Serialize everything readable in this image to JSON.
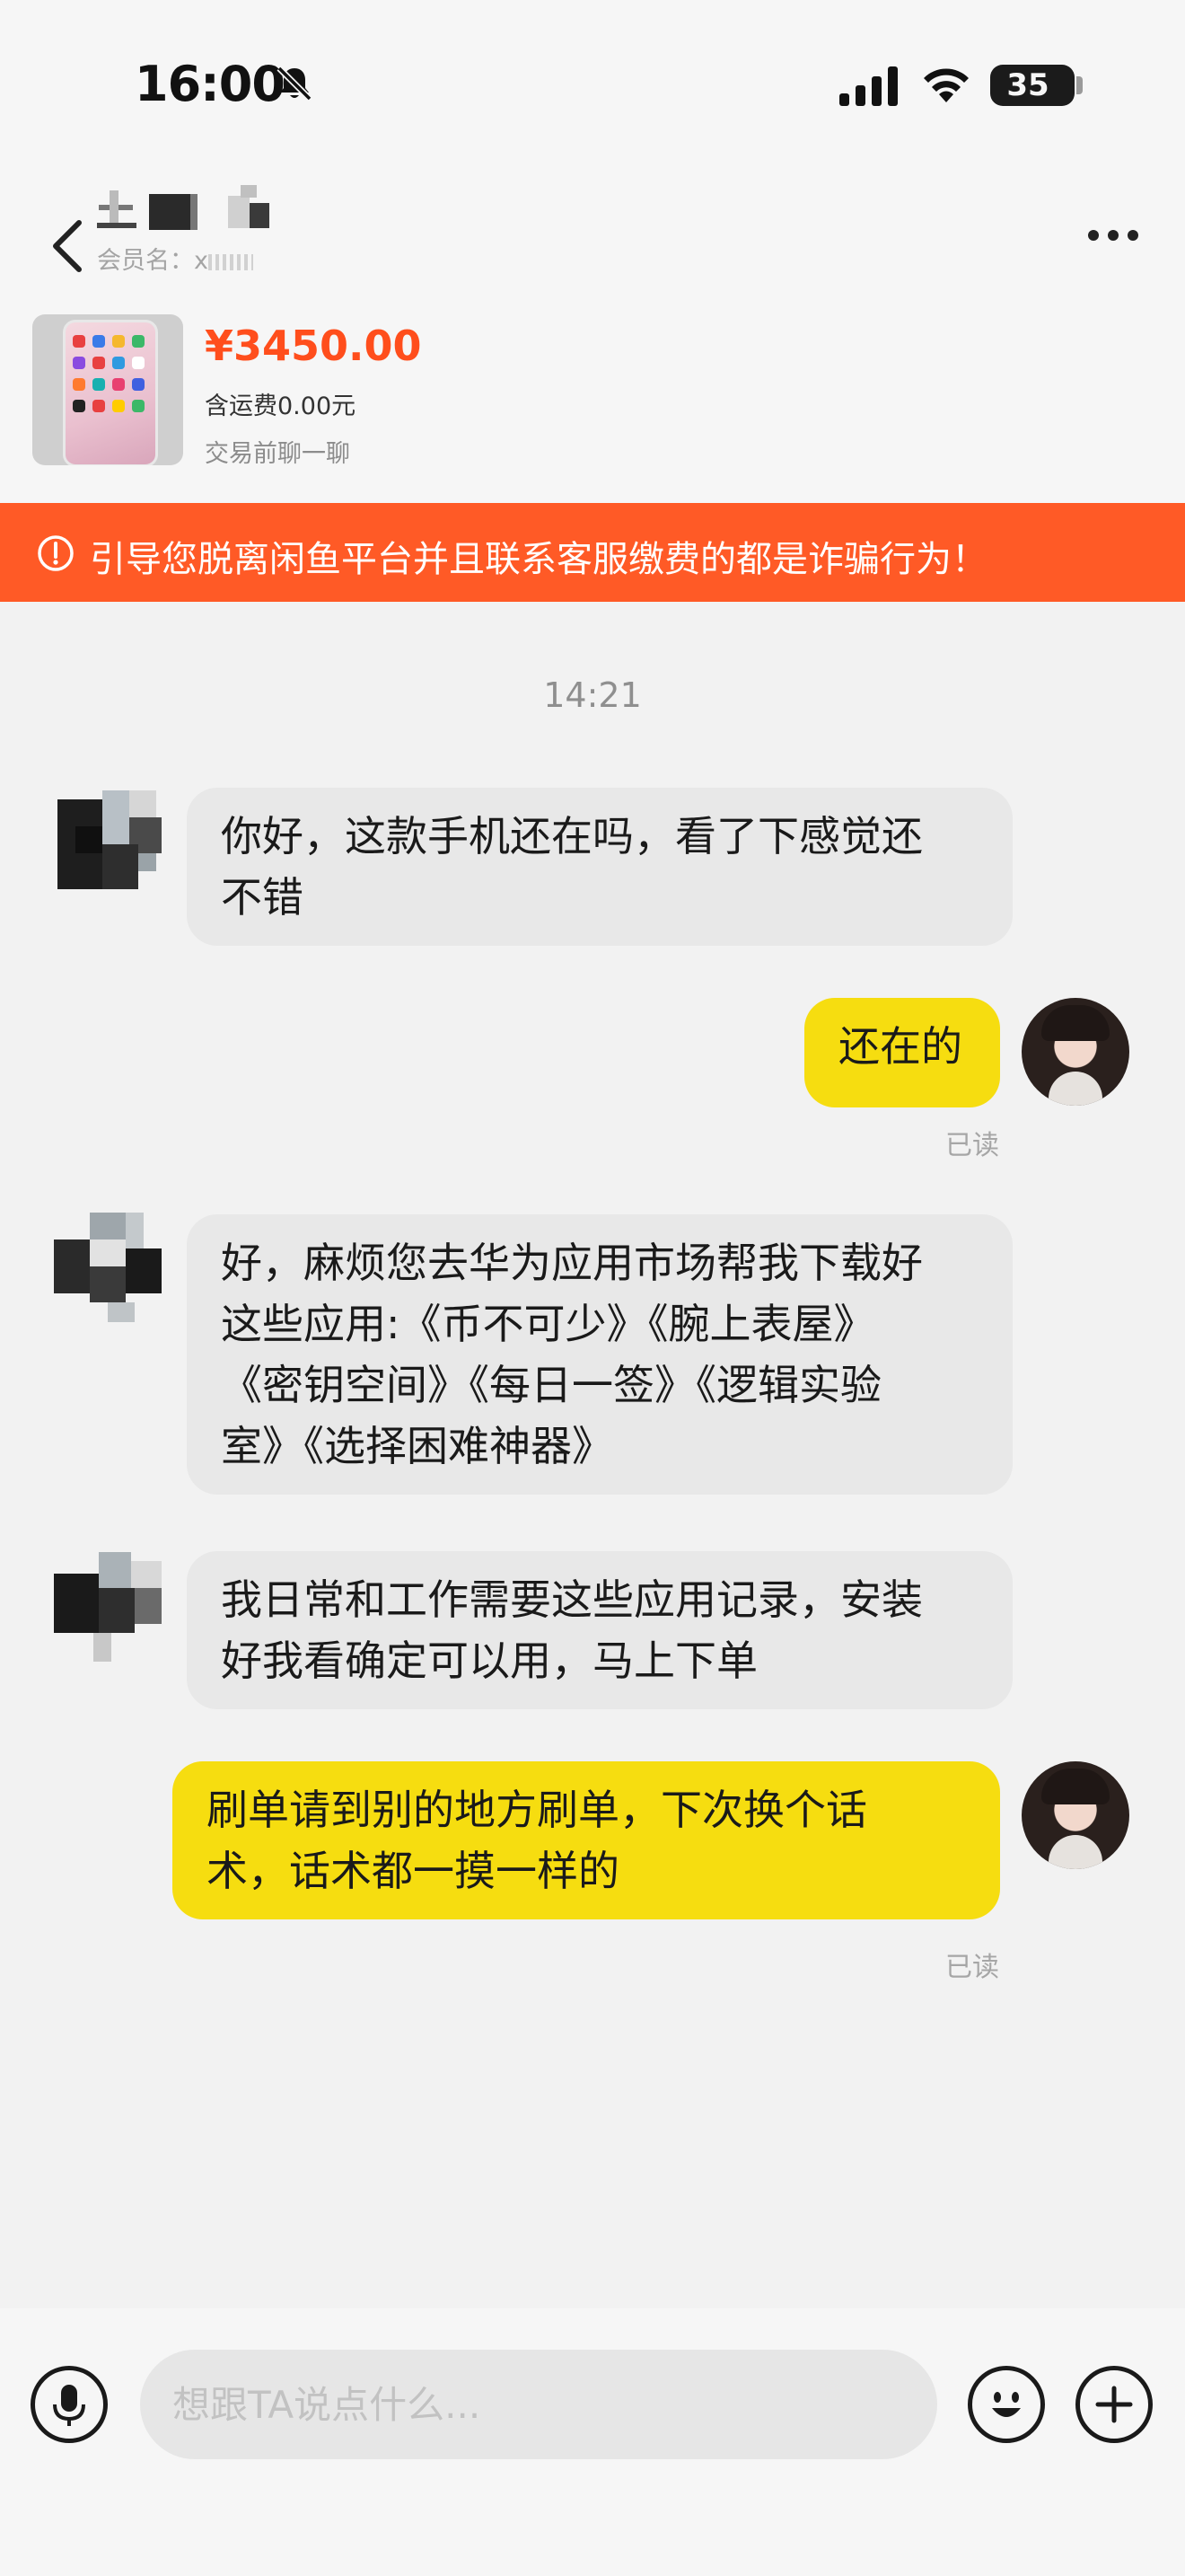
{
  "status_bar": {
    "time": "16:00",
    "battery": "35",
    "icons": [
      "bell-muted-icon",
      "cellular-signal-icon",
      "wifi-icon",
      "battery-icon"
    ]
  },
  "header": {
    "member_label": "会员名：x",
    "icons": [
      "back-arrow-icon",
      "more-dots-icon"
    ]
  },
  "product": {
    "price": "¥3450.00",
    "shipping": "含运费0.00元",
    "hint": "交易前聊一聊"
  },
  "warning": {
    "text": "引导您脱离闲鱼平台并且联系客服缴费的都是诈骗行为！",
    "icon": "exclamation-circle-icon"
  },
  "conversation": {
    "timestamp": "14:21",
    "messages": [
      {
        "from": "other",
        "lines": [
          "你好，这款手机还在吗，看了下感觉还",
          "不错"
        ]
      },
      {
        "from": "me",
        "lines": [
          "还在的"
        ],
        "status": "已读"
      },
      {
        "from": "other",
        "lines": [
          "好，麻烦您去华为应用市场帮我下载好",
          "这些应用:《币不可少》《腕上表屋》",
          "《密钥空间》《每日一签》《逻辑实验",
          "室》《选择困难神器》"
        ]
      },
      {
        "from": "other",
        "lines": [
          "我日常和工作需要这些应用记录，安装",
          "好我看确定可以用，马上下单"
        ]
      },
      {
        "from": "me",
        "lines": [
          "刷单请到别的地方刷单，下次换个话",
          "术，话术都一摸一样的"
        ],
        "status": "已读"
      }
    ]
  },
  "input_bar": {
    "placeholder": "想跟TA说点什么...",
    "icons": [
      "microphone-icon",
      "emoji-icon",
      "plus-icon"
    ]
  },
  "colors": {
    "accent_orange": "#ff5a26",
    "price_color": "#ff4e1c",
    "my_bubble": "#f6dd10",
    "other_bubble": "#e8e8e8"
  }
}
